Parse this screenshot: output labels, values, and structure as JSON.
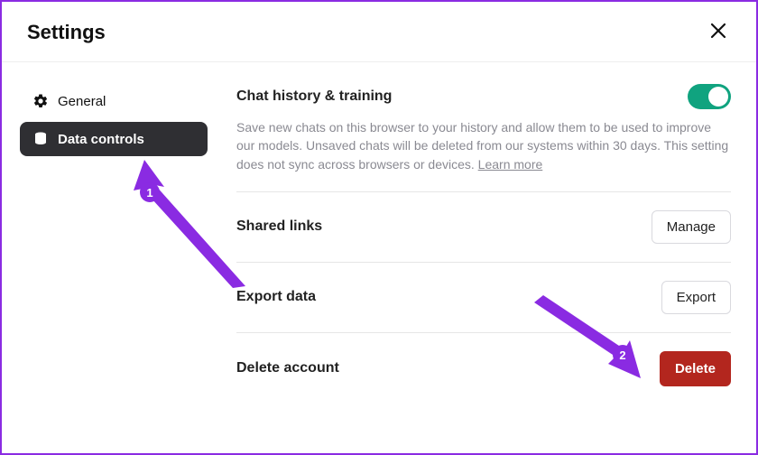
{
  "header": {
    "title": "Settings"
  },
  "sidebar": {
    "items": [
      {
        "label": "General"
      },
      {
        "label": "Data controls"
      }
    ]
  },
  "content": {
    "chat_history": {
      "title": "Chat history & training",
      "desc_prefix": "Save new chats on this browser to your history and allow them to be used to improve our models. Unsaved chats will be deleted from our systems within 30 days. This setting does not sync across browsers or devices. ",
      "learn_more": "Learn more",
      "toggle_on": true
    },
    "shared_links": {
      "title": "Shared links",
      "button": "Manage"
    },
    "export_data": {
      "title": "Export data",
      "button": "Export"
    },
    "delete_account": {
      "title": "Delete account",
      "button": "Delete"
    }
  },
  "annotations": {
    "one": "1",
    "two": "2"
  }
}
